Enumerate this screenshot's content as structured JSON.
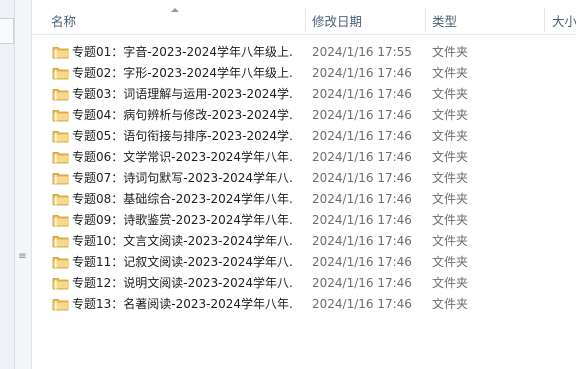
{
  "header": {
    "col_name": "名称",
    "col_date": "修改日期",
    "col_type": "类型",
    "col_size": "大小"
  },
  "files": [
    {
      "name": "专题01：字音-2023-2024学年八年级上...",
      "date": "2024/1/16 17:55",
      "type": "文件夹"
    },
    {
      "name": "专题02：字形-2023-2024学年八年级上...",
      "date": "2024/1/16 17:46",
      "type": "文件夹"
    },
    {
      "name": "专题03：词语理解与运用-2023-2024学...",
      "date": "2024/1/16 17:46",
      "type": "文件夹"
    },
    {
      "name": "专题04：病句辨析与修改-2023-2024学...",
      "date": "2024/1/16 17:46",
      "type": "文件夹"
    },
    {
      "name": "专题05：语句衔接与排序-2023-2024学...",
      "date": "2024/1/16 17:46",
      "type": "文件夹"
    },
    {
      "name": "专题06：文学常识-2023-2024学年八年...",
      "date": "2024/1/16 17:46",
      "type": "文件夹"
    },
    {
      "name": "专题07：诗词句默写-2023-2024学年八...",
      "date": "2024/1/16 17:46",
      "type": "文件夹"
    },
    {
      "name": "专题08：基础综合-2023-2024学年八年...",
      "date": "2024/1/16 17:46",
      "type": "文件夹"
    },
    {
      "name": "专题09：诗歌鉴赏-2023-2024学年八年...",
      "date": "2024/1/16 17:46",
      "type": "文件夹"
    },
    {
      "name": "专题10：文言文阅读-2023-2024学年八...",
      "date": "2024/1/16 17:46",
      "type": "文件夹"
    },
    {
      "name": "专题11：记叙文阅读-2023-2024学年八...",
      "date": "2024/1/16 17:46",
      "type": "文件夹"
    },
    {
      "name": "专题12：说明文阅读-2023-2024学年八...",
      "date": "2024/1/16 17:46",
      "type": "文件夹"
    },
    {
      "name": "专题13：名著阅读-2023-2024学年八年...",
      "date": "2024/1/16 17:46",
      "type": "文件夹"
    }
  ],
  "colors": {
    "folder_body": "#e8b84a",
    "folder_light": "#f6d98a",
    "header_text": "#4c607a"
  },
  "icons": {
    "folder": "folder-icon",
    "sort": "sort-ascending-icon"
  }
}
